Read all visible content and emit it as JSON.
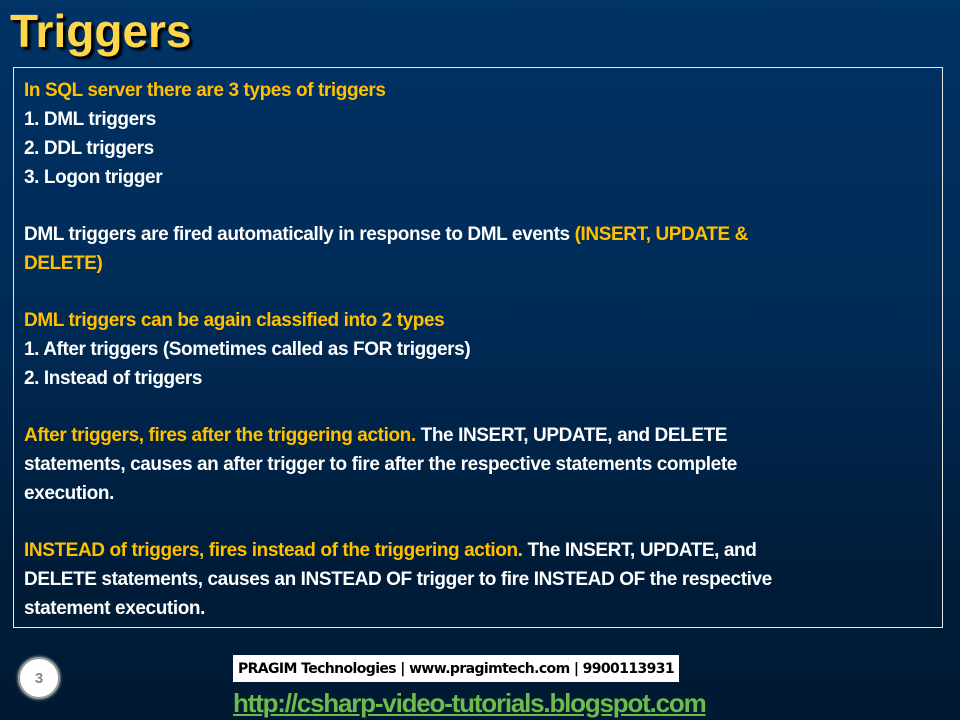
{
  "title": "Triggers",
  "lines": [
    [
      {
        "text": "In SQL server there are 3 types of triggers",
        "hl": true
      }
    ],
    [
      {
        "text": "1. DML triggers",
        "hl": false
      }
    ],
    [
      {
        "text": "2. DDL triggers",
        "hl": false
      }
    ],
    [
      {
        "text": "3. Logon trigger",
        "hl": false
      }
    ],
    [],
    [
      {
        "text": "DML triggers are fired automatically in response to DML events ",
        "hl": false
      },
      {
        "text": "(INSERT, UPDATE &",
        "hl": true
      }
    ],
    [
      {
        "text": "DELETE)",
        "hl": true
      }
    ],
    [],
    [
      {
        "text": "DML triggers can be again classified into 2 types",
        "hl": true
      }
    ],
    [
      {
        "text": "1. After triggers (Sometimes called as FOR triggers)",
        "hl": false
      }
    ],
    [
      {
        "text": "2. Instead of triggers",
        "hl": false
      }
    ],
    [],
    [
      {
        "text": "After triggers, fires after the triggering action. ",
        "hl": true
      },
      {
        "text": "The INSERT, UPDATE, and DELETE",
        "hl": false
      }
    ],
    [
      {
        "text": "statements, causes an after trigger to fire after the respective statements complete",
        "hl": false
      }
    ],
    [
      {
        "text": "execution.",
        "hl": false
      }
    ],
    [],
    [
      {
        "text": "INSTEAD of triggers, fires instead of the triggering action. ",
        "hl": true
      },
      {
        "text": "The INSERT, UPDATE, and",
        "hl": false
      }
    ],
    [
      {
        "text": "DELETE statements, causes an INSTEAD OF trigger to fire INSTEAD OF the respective",
        "hl": false
      }
    ],
    [
      {
        "text": "statement execution.",
        "hl": false
      }
    ]
  ],
  "slide_number": "3",
  "footer": "PRAGIM Technologies | www.pragimtech.com | 9900113931",
  "link": "http://csharp-video-tutorials.blogspot.com",
  "colors": {
    "title": "#ffd54a",
    "highlight": "#ffc000",
    "text": "#ffffff",
    "link": "#6dbb4a",
    "background": "#003366"
  }
}
